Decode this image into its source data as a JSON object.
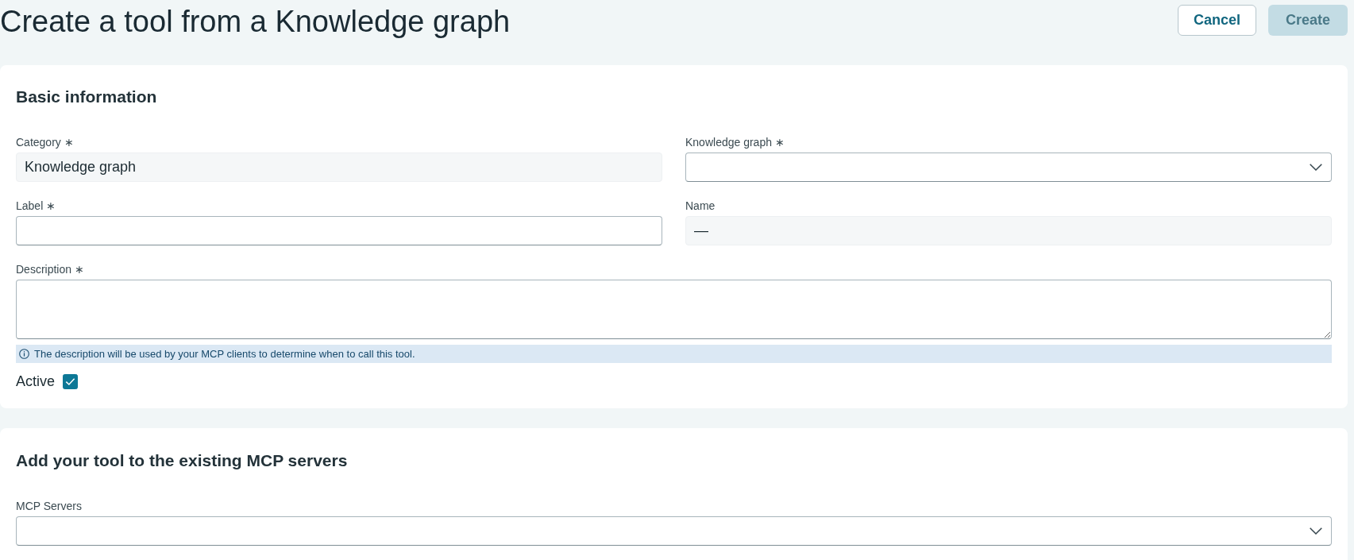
{
  "header": {
    "title": "Create a tool from a Knowledge graph",
    "buttons": [
      {
        "label": "Cancel",
        "kind": "secondary",
        "disabled": false
      },
      {
        "label": "Create",
        "kind": "primary",
        "disabled": true
      }
    ]
  },
  "sections": [
    {
      "title": "Basic information",
      "rows": [
        [
          {
            "label": "Category ∗",
            "kind": "text",
            "disabled": true,
            "value": "Knowledge graph"
          },
          {
            "label": "Knowledge graph ∗",
            "kind": "select",
            "disabled": false
          }
        ],
        [
          {
            "label": "Label ∗",
            "kind": "text",
            "disabled": false
          },
          {
            "label": "Name",
            "kind": "text",
            "disabled": true,
            "value": "—"
          }
        ],
        [
          {
            "label": "Description ∗",
            "kind": "textarea",
            "disabled": false
          }
        ]
      ],
      "info": {
        "text": "The description will be used by your MCP clients to determine when to call this tool."
      },
      "checkbox": {
        "label": "Active",
        "checked": true
      }
    },
    {
      "title": "Add your tool to the existing MCP servers",
      "rows": [
        [
          {
            "label": "MCP Servers",
            "kind": "select",
            "disabled": false
          }
        ]
      ]
    }
  ]
}
